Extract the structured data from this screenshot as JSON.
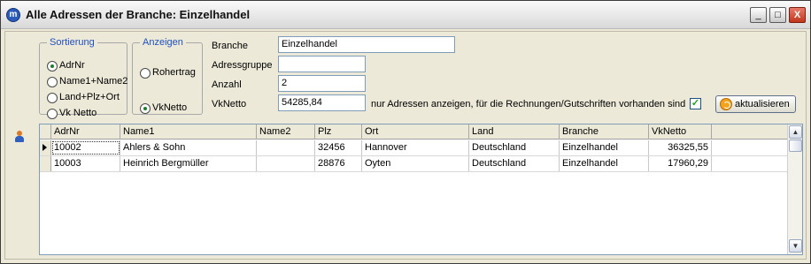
{
  "window": {
    "title": "Alle Adressen der Branche: Einzelhandel",
    "icon": "app-logo-icon",
    "buttons": {
      "minimize": "_",
      "maximize": "□",
      "close": "X"
    }
  },
  "sortierung": {
    "legend": "Sortierung",
    "options": [
      "AdrNr",
      "Name1+Name2",
      "Land+Plz+Ort",
      "Vk Netto"
    ],
    "selected": "AdrNr"
  },
  "anzeigen": {
    "legend": "Anzeigen",
    "options": [
      "Rohertrag",
      "VkNetto"
    ],
    "selected": "VkNetto"
  },
  "form": {
    "branche_label": "Branche",
    "branche_value": "Einzelhandel",
    "adressgruppe_label": "Adressgruppe",
    "adressgruppe_value": "",
    "anzahl_label": "Anzahl",
    "anzahl_value": "2",
    "vknetto_label": "VkNetto",
    "vknetto_value": "54285,84",
    "filter_text": "nur Adressen anzeigen, für die Rechnungen/Gutschriften vorhanden sind",
    "filter_checked": true,
    "refresh_label": "aktualisieren"
  },
  "grid": {
    "columns": [
      "AdrNr",
      "Name1",
      "Name2",
      "Plz",
      "Ort",
      "Land",
      "Branche",
      "VkNetto"
    ],
    "rows": [
      [
        "10002",
        "Ahlers & Sohn",
        "",
        "32456",
        "Hannover",
        "Deutschland",
        "Einzelhandel",
        "36325,55"
      ],
      [
        "10003",
        "Heinrich Bergmüller",
        "",
        "28876",
        "Oyten",
        "Deutschland",
        "Einzelhandel",
        "17960,29"
      ]
    ],
    "current_row": 0
  }
}
